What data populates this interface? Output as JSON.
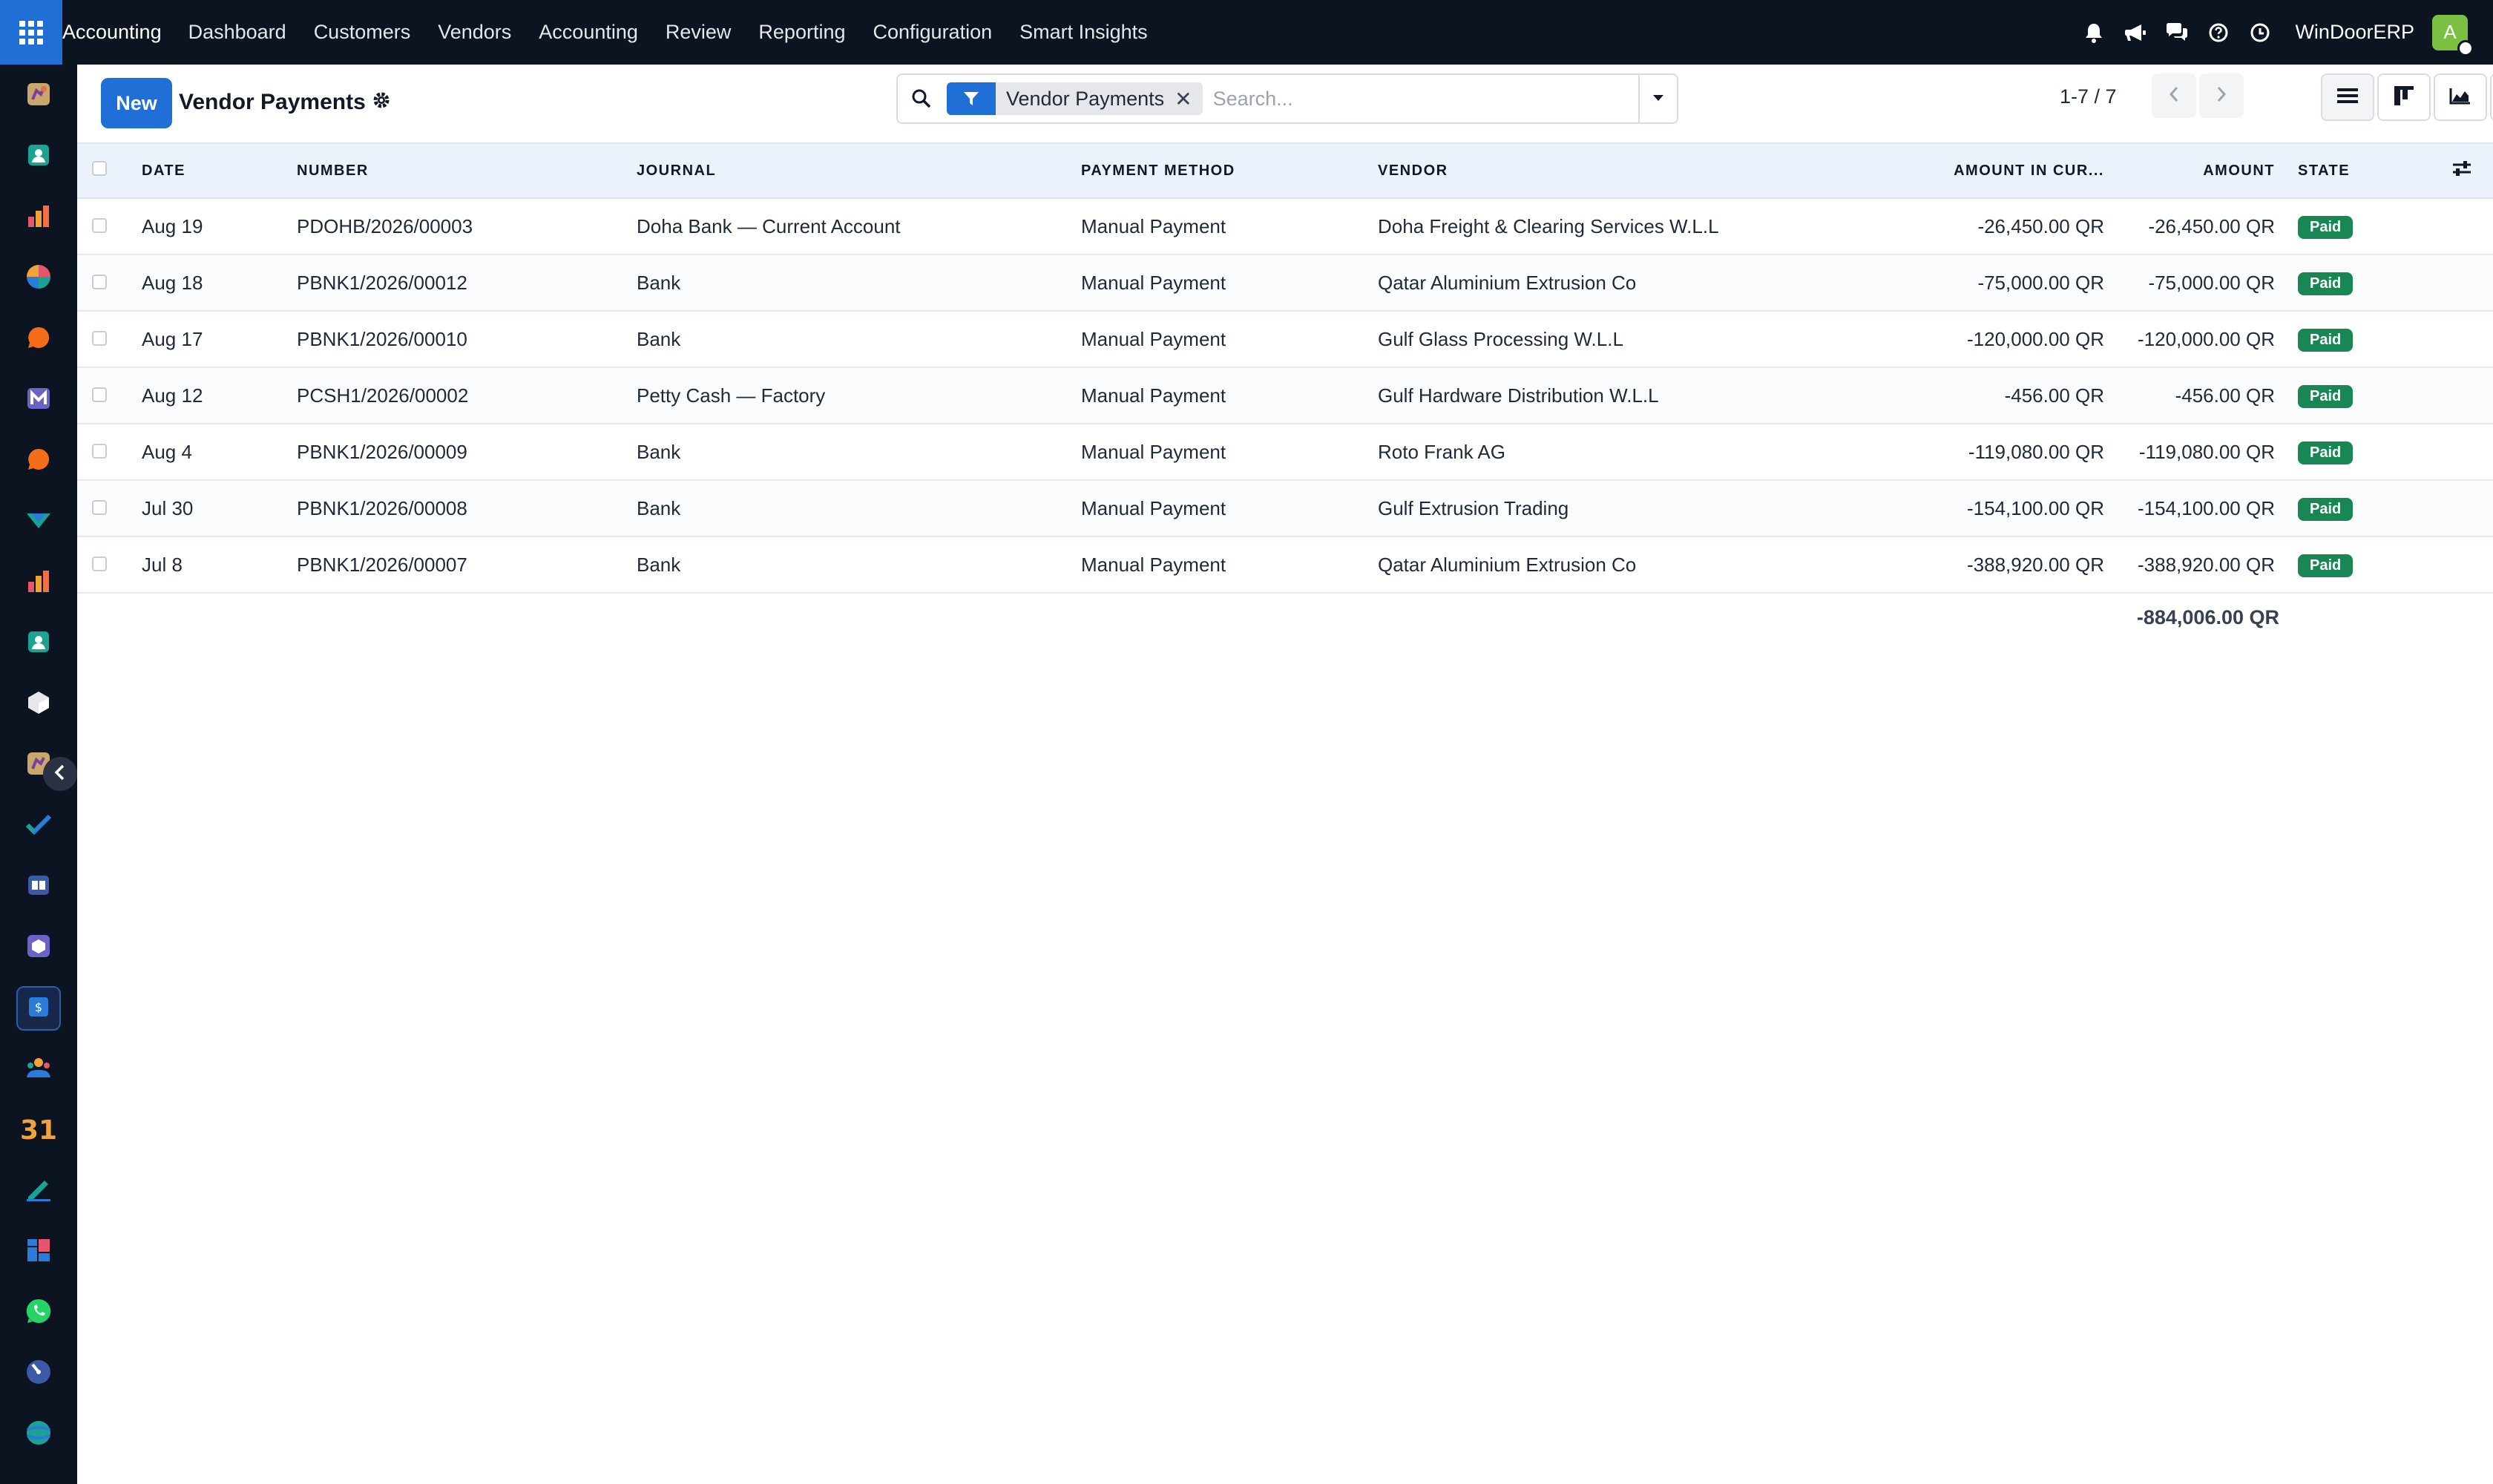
{
  "navbar": {
    "app_name": "Accounting",
    "menu": [
      "Dashboard",
      "Customers",
      "Vendors",
      "Accounting",
      "Review",
      "Reporting",
      "Configuration",
      "Smart Insights"
    ],
    "company": "WinDoorERP",
    "avatar_letter": "A"
  },
  "sidebar": {
    "apps": [
      "discuss-icon",
      "contacts-icon",
      "reporting-icon",
      "pie-chart-icon",
      "chat-bubble-icon",
      "mail-icon",
      "chat-bubble-icon",
      "routing-icon",
      "reporting-icon",
      "contacts-icon",
      "inventory-box-icon",
      "discuss-icon",
      "project-check-icon",
      "knowledge-book-icon",
      "package-icon",
      "accounting-invoice-icon",
      "employees-icon",
      "calendar-icon",
      "sign-icon",
      "dashboards-icon",
      "whatsapp-icon",
      "timer-icon",
      "website-icon"
    ],
    "active_index": 15,
    "calendar_label": "31"
  },
  "control": {
    "new_label": "New",
    "title": "Vendor Payments",
    "facet_label": "Vendor Payments",
    "search_placeholder": "Search...",
    "pager": "1-7 / 7"
  },
  "table": {
    "columns": [
      "Date",
      "Number",
      "Journal",
      "Payment Method",
      "Vendor",
      "Amount in Cur...",
      "Amount",
      "State"
    ],
    "rows": [
      {
        "date": "Aug 19",
        "number": "PDOHB/2026/00003",
        "journal": "Doha Bank — Current Account",
        "method": "Manual Payment",
        "vendor": "Doha Freight & Clearing Services W.L.L",
        "amount_currency": "-26,450.00 QR",
        "amount": "-26,450.00 QR",
        "state": "Paid"
      },
      {
        "date": "Aug 18",
        "number": "PBNK1/2026/00012",
        "journal": "Bank",
        "method": "Manual Payment",
        "vendor": "Qatar Aluminium Extrusion Co",
        "amount_currency": "-75,000.00 QR",
        "amount": "-75,000.00 QR",
        "state": "Paid"
      },
      {
        "date": "Aug 17",
        "number": "PBNK1/2026/00010",
        "journal": "Bank",
        "method": "Manual Payment",
        "vendor": "Gulf Glass Processing W.L.L",
        "amount_currency": "-120,000.00 QR",
        "amount": "-120,000.00 QR",
        "state": "Paid"
      },
      {
        "date": "Aug 12",
        "number": "PCSH1/2026/00002",
        "journal": "Petty Cash — Factory",
        "method": "Manual Payment",
        "vendor": "Gulf Hardware Distribution W.L.L",
        "amount_currency": "-456.00 QR",
        "amount": "-456.00 QR",
        "state": "Paid"
      },
      {
        "date": "Aug 4",
        "number": "PBNK1/2026/00009",
        "journal": "Bank",
        "method": "Manual Payment",
        "vendor": "Roto Frank AG",
        "amount_currency": "-119,080.00 QR",
        "amount": "-119,080.00 QR",
        "state": "Paid"
      },
      {
        "date": "Jul 30",
        "number": "PBNK1/2026/00008",
        "journal": "Bank",
        "method": "Manual Payment",
        "vendor": "Gulf Extrusion Trading",
        "amount_currency": "-154,100.00 QR",
        "amount": "-154,100.00 QR",
        "state": "Paid"
      },
      {
        "date": "Jul 8",
        "number": "PBNK1/2026/00007",
        "journal": "Bank",
        "method": "Manual Payment",
        "vendor": "Qatar Aluminium Extrusion Co",
        "amount_currency": "-388,920.00 QR",
        "amount": "-388,920.00 QR",
        "state": "Paid"
      }
    ],
    "total": "-884,006.00 QR"
  },
  "colors": {
    "navbar_bg": "#0c1321",
    "primary": "#1f6fd6",
    "paid_badge": "#198754",
    "header_bg": "#ebf2fb"
  }
}
